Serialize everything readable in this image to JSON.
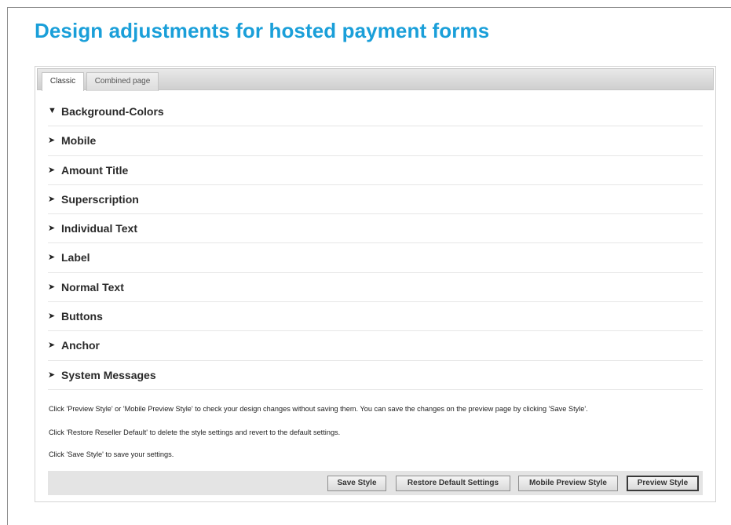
{
  "page": {
    "title": "Design adjustments for hosted payment forms"
  },
  "tabs": [
    {
      "label": "Classic",
      "active": true
    },
    {
      "label": "Combined page",
      "active": false
    }
  ],
  "sections": [
    {
      "label": "Background-Colors",
      "arrow": "▼",
      "expanded": true
    },
    {
      "label": "Mobile",
      "arrow": "➤",
      "expanded": false
    },
    {
      "label": "Amount Title",
      "arrow": "➤",
      "expanded": false
    },
    {
      "label": "Superscription",
      "arrow": "➤",
      "expanded": false
    },
    {
      "label": "Individual Text",
      "arrow": "➤",
      "expanded": false
    },
    {
      "label": "Label",
      "arrow": "➤",
      "expanded": false
    },
    {
      "label": "Normal Text",
      "arrow": "➤",
      "expanded": false
    },
    {
      "label": "Buttons",
      "arrow": "➤",
      "expanded": false
    },
    {
      "label": "Anchor",
      "arrow": "➤",
      "expanded": false
    },
    {
      "label": "System Messages",
      "arrow": "➤",
      "expanded": false
    }
  ],
  "info": {
    "preview_hint": "Click 'Preview Style' or 'Mobile Preview Style' to check your design changes without saving them. You can save the changes on the preview page by clicking 'Save Style'.",
    "restore_hint": "Click 'Restore Reseller Default' to delete the style settings and revert to the default settings.",
    "save_hint": "Click 'Save Style' to save your settings."
  },
  "buttons": {
    "save_style": "Save Style",
    "restore_default": "Restore Default Settings",
    "mobile_preview": "Mobile Preview Style",
    "preview": "Preview Style"
  },
  "colors": {
    "title": "#1a9fd9"
  }
}
